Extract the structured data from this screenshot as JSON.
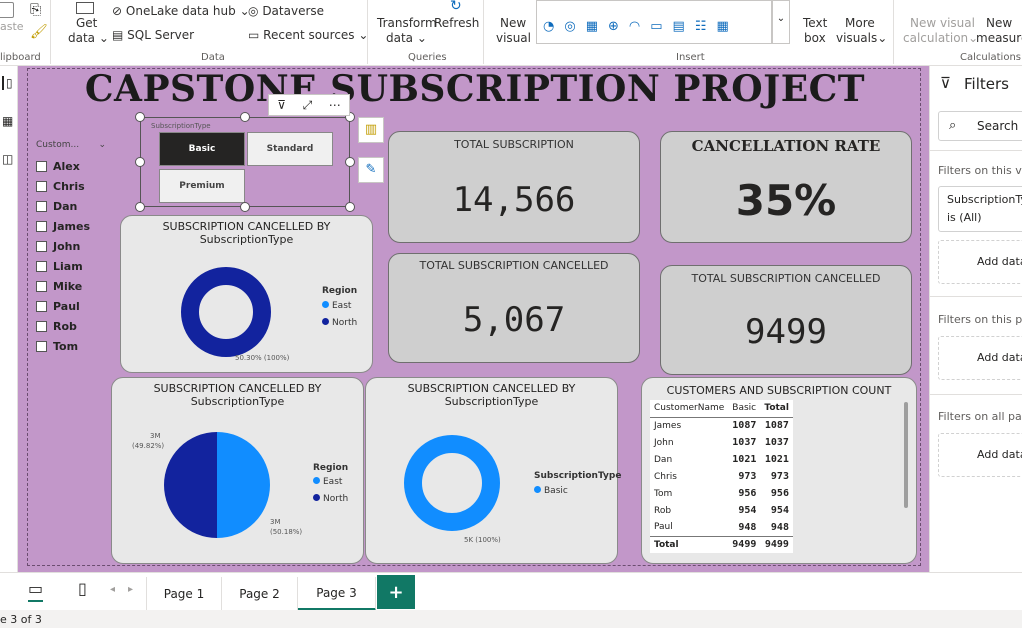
{
  "ribbon": {
    "clipboard": {
      "paste": "aste",
      "group": "lipboard"
    },
    "data": {
      "get_data": "Get",
      "get_data2": "data",
      "onelake": "OneLake data hub",
      "sql": "SQL Server",
      "dataverse": "Dataverse",
      "recent": "Recent sources",
      "group": "Data"
    },
    "queries": {
      "transform": "Transform",
      "transform2": "data",
      "refresh": "Refresh",
      "group": "Queries"
    },
    "insert": {
      "new_visual": "New",
      "new_visual2": "visual",
      "text_box": "Text",
      "text_box2": "box",
      "more_visuals": "More",
      "more_visuals2": "visuals",
      "group": "Insert"
    },
    "calculations": {
      "new_visual_calc": "New visual",
      "new_visual_calc2": "calculation",
      "new_measure": "New",
      "new_measure2": "measure",
      "group": "Calculations"
    }
  },
  "report": {
    "title": "CAPSTONE SUBSCRIPTION PROJECT",
    "customer_slicer": {
      "header": "Custom...",
      "items": [
        "Alex",
        "Chris",
        "Dan",
        "James",
        "John",
        "Liam",
        "Mike",
        "Paul",
        "Rob",
        "Tom"
      ]
    },
    "type_slicer": {
      "header": "SubscriptionType",
      "buttons": [
        "Basic",
        "Standard",
        "Premium"
      ]
    },
    "cards": {
      "total_subscription": {
        "label": "TOTAL SUBSCRIPTION",
        "value": "14,566"
      },
      "cancellation_rate": {
        "label": "CANCELLATION RATE",
        "value": "35%"
      },
      "total_cancelled_1": {
        "label": "TOTAL SUBSCRIPTION CANCELLED",
        "value": "5,067"
      },
      "total_cancelled_2": {
        "label": "TOTAL SUBSCRIPTION CANCELLED",
        "value": "9499"
      }
    },
    "donut_top": {
      "title1": "SUBSCRIPTION CANCELLED BY",
      "title2": "SubscriptionType",
      "legend_title": "Region",
      "legend": [
        "East",
        "North"
      ],
      "data_label": "50.30% (100%)"
    },
    "pie_left": {
      "title1": "SUBSCRIPTION CANCELLED BY",
      "title2": "SubscriptionType",
      "legend_title": "Region",
      "legend": [
        "East",
        "North"
      ],
      "label_north": "3M",
      "label_north_pct": "(49.82%)",
      "label_east": "3M",
      "label_east_pct": "(50.18%)"
    },
    "donut_mid": {
      "title1": "SUBSCRIPTION CANCELLED BY",
      "title2": "SubscriptionType",
      "legend_title": "SubscriptionType",
      "legend": [
        "Basic"
      ],
      "data_label": "5K (100%)"
    },
    "table": {
      "title": "CUSTOMERS AND SUBSCRIPTION COUNT",
      "columns": [
        "CustomerName",
        "Basic",
        "Total"
      ],
      "rows": [
        [
          "James",
          "1087",
          "1087"
        ],
        [
          "John",
          "1037",
          "1037"
        ],
        [
          "Dan",
          "1021",
          "1021"
        ],
        [
          "Chris",
          "973",
          "973"
        ],
        [
          "Tom",
          "956",
          "956"
        ],
        [
          "Rob",
          "954",
          "954"
        ],
        [
          "Paul",
          "948",
          "948"
        ]
      ],
      "total_row": [
        "Total",
        "9499",
        "9499"
      ]
    }
  },
  "filters": {
    "title": "Filters",
    "search": "Search",
    "on_visual": "Filters on this vis",
    "visual_filter": "SubscriptionTy",
    "visual_filter2": "is (All)",
    "add_data": "Add data",
    "on_page": "Filters on this pa",
    "on_all": "Filters on all pag"
  },
  "tabs": [
    "Page 1",
    "Page 2",
    "Page 3"
  ],
  "add_tab": "+",
  "status": "e 3 of 3",
  "colors": {
    "canvas": "#c297c9",
    "east": "#118dff",
    "north": "#12239e",
    "basic": "#118dff",
    "tab_add": "#117865"
  }
}
